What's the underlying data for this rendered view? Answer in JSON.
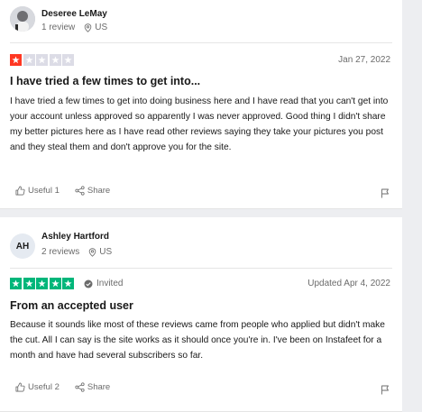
{
  "reviews": [
    {
      "reviewer_name": "Deseree LeMay",
      "review_count": "1 review",
      "location": "US",
      "rating": 1,
      "date": "Jan 27, 2022",
      "title": "I have tried a few times to get into...",
      "body": "I have tried a few times to get into doing business here and I have read that you can't get into your account unless approved so apparently I was never approved. Good thing I didn't share my better pictures here as I have read other reviews saying they take your pictures you post and they steal them and don't approve you for the site.",
      "useful_label": "Useful 1",
      "share_label": "Share"
    },
    {
      "reviewer_name": "Ashley Hartford",
      "initials": "AH",
      "review_count": "2 reviews",
      "location": "US",
      "rating": 5,
      "invited_label": "Invited",
      "date": "Updated Apr 4, 2022",
      "title": "From an accepted user",
      "body": "Because it sounds like most of these reviews came from people who applied but didn't make the cut. All I can say is the site works as it should once you're in. I've been on Instafeet for a month and have had several subscribers so far.",
      "useful_label": "Useful 2",
      "share_label": "Share"
    }
  ],
  "colors": {
    "star_one": "#ff3722",
    "star_five": "#00b67a",
    "star_empty": "#dcdce6"
  }
}
